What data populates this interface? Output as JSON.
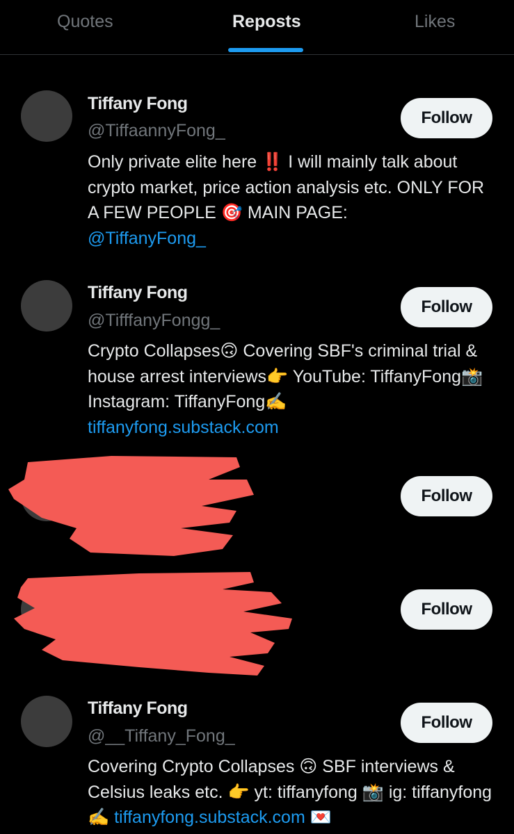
{
  "tabs": [
    {
      "label": "Quotes"
    },
    {
      "label": "Reposts"
    },
    {
      "label": "Likes"
    }
  ],
  "accent_color": "#1d9bf0",
  "redaction_color": "#f45b55",
  "users": [
    {
      "name": "Tiffany Fong",
      "handle": "@TiffaannyFong_",
      "follow_label": "Follow",
      "bio": {
        "p1": "Only private elite here ",
        "e1": "‼️",
        "p2": " I will mainly talk about crypto market, price action analysis etc. ONLY FOR A FEW PEOPLE ",
        "e2": "🎯",
        "p3": " MAIN PAGE: ",
        "link": "@TiffanyFong_"
      }
    },
    {
      "name": "Tiffany Fong",
      "handle": "@TifffanyFongg_",
      "follow_label": "Follow",
      "bio": {
        "p1": "Crypto Collapses",
        "e1": "🙃",
        "p2": " Covering SBF's criminal trial & house arrest interviews",
        "e2": "👉",
        "p3": " YouTube: TiffanyFong",
        "e3": "📸",
        "p4": " Instagram: TiffanyFong",
        "e4": "✍️",
        "link": "tiffanyfong.substack.com"
      }
    },
    {
      "follow_label": "Follow"
    },
    {
      "follow_label": "Follow"
    },
    {
      "name": "Tiffany Fong",
      "handle": "@__Tiffany_Fong_",
      "follow_label": "Follow",
      "bio": {
        "p1": "Covering Crypto Collapses ",
        "e1": "🙃",
        "p2": " SBF interviews & Celsius leaks etc. ",
        "e2": "👉",
        "p3": " yt: tiffanyfong ",
        "e3": "📸",
        "p4": " ig: tiffanyfong ",
        "e4": "✍️",
        "link": "tiffanyfong.substack.com",
        "e5": "💌"
      }
    }
  ]
}
